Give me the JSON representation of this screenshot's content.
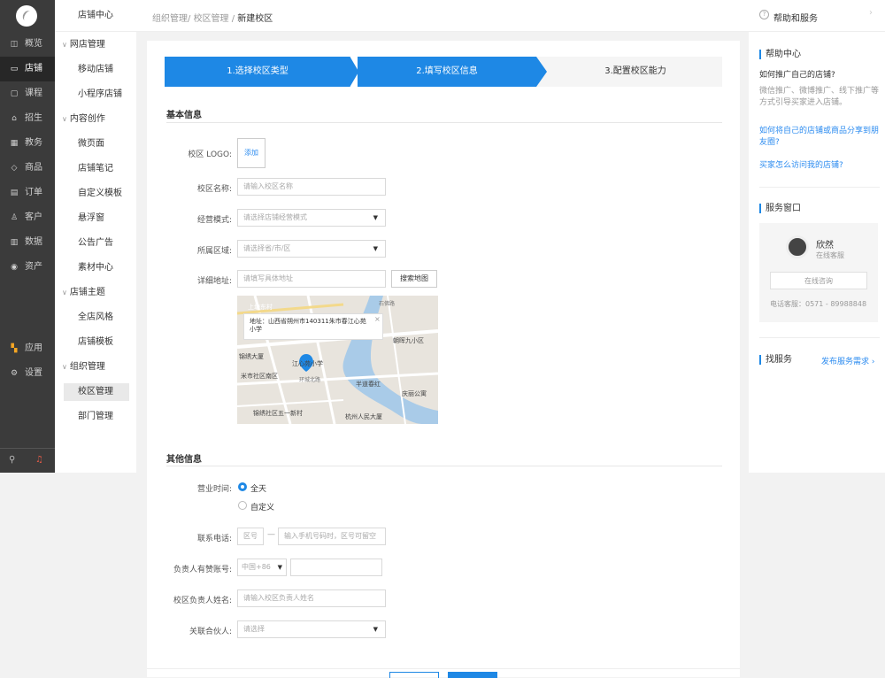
{
  "nav": {
    "items": [
      {
        "icon": "monitor-icon",
        "glyph": "◫",
        "label": "概览"
      },
      {
        "icon": "store-icon",
        "glyph": "▭",
        "label": "店铺"
      },
      {
        "icon": "course-icon",
        "glyph": "▢",
        "label": "课程"
      },
      {
        "icon": "recruit-icon",
        "glyph": "⌂",
        "label": "招生"
      },
      {
        "icon": "teaching-icon",
        "glyph": "▦",
        "label": "教务"
      },
      {
        "icon": "tag-icon",
        "glyph": "◇",
        "label": "商品"
      },
      {
        "icon": "order-icon",
        "glyph": "▤",
        "label": "订单"
      },
      {
        "icon": "user-icon",
        "glyph": "♙",
        "label": "客户"
      },
      {
        "icon": "chart-icon",
        "glyph": "▥",
        "label": "数据"
      },
      {
        "icon": "asset-icon",
        "glyph": "◉",
        "label": "资产"
      }
    ],
    "apps_label": "应用",
    "settings_label": "设置",
    "active_index": 1
  },
  "sidebar": {
    "header": "店铺中心",
    "groups": [
      {
        "label": "网店管理",
        "items": [
          "移动店铺",
          "小程序店铺"
        ]
      },
      {
        "label": "内容创作",
        "items": [
          "微页面",
          "店铺笔记",
          "自定义模板",
          "悬浮窗",
          "公告广告",
          "素材中心"
        ]
      },
      {
        "label": "店铺主题",
        "items": [
          "全店风格",
          "店铺模板"
        ]
      },
      {
        "label": "组织管理",
        "items": [
          "校区管理",
          "部门管理"
        ]
      }
    ],
    "active_item": "校区管理"
  },
  "breadcrumb": {
    "parts": [
      "组织管理/ ",
      "校区管理 / "
    ],
    "current": "新建校区"
  },
  "help_header": {
    "title": "帮助和服务",
    "chevron": "›"
  },
  "steps": [
    "1.选择校区类型",
    "2.填写校区信息",
    "3.配置校区能力"
  ],
  "basic": {
    "section_title": "基本信息",
    "logo_label": "校区 LOGO:",
    "logo_add": "添加",
    "name_label": "校区名称:",
    "name_placeholder": "请输入校区名称",
    "mode_label": "经营模式:",
    "mode_placeholder": "请选择店铺经营模式",
    "area_label": "所属区域:",
    "area_placeholder": "请选择省/市/区",
    "address_label": "详细地址:",
    "address_placeholder": "请填写具体地址",
    "search_map_button": "搜索地图"
  },
  "map": {
    "popup_text": "地址：山西省朔州市140311朱市春江心苑小学",
    "labels": [
      "上塘东村",
      "朝晖九小区",
      "锦绣大厦",
      "江心苑小学",
      "米市社区南区",
      "半道春红",
      "庆丽公寓",
      "锦绣社区五一新村",
      "杭州人民大厦",
      "石佛路",
      "环城北路"
    ]
  },
  "other": {
    "section_title": "其他信息",
    "hours_label": "营业时间:",
    "hours_options": [
      "全天",
      "自定义"
    ],
    "phone_label": "联系电话:",
    "phone_area_placeholder": "区号",
    "phone_dash": "—",
    "phone_placeholder": "输入手机号码时，区号可留空",
    "wechat_label": "负责人有赞账号:",
    "country_code": "中国+86",
    "manager_label": "校区负责人姓名:",
    "manager_placeholder": "请输入校区负责人姓名",
    "partner_label": "关联合伙人:",
    "partner_placeholder": "请选择"
  },
  "help": {
    "center_title": "帮助中心",
    "q1": "如何推广自己的店铺?",
    "a1": "微信推广、微博推广、线下推广等方式引导买家进入店铺。",
    "link1": "如何将自己的店铺或商品分享到朋友圈?",
    "link2": "买家怎么访问我的店铺?",
    "service_title": "服务窗口",
    "agent_name": "欣然",
    "agent_role": "在线客服",
    "consult_button": "在线咨询",
    "phone_text": "电话客服：0571 - 89988848",
    "find_service": "找服务",
    "publish_demand": "发布服务需求 ›"
  }
}
